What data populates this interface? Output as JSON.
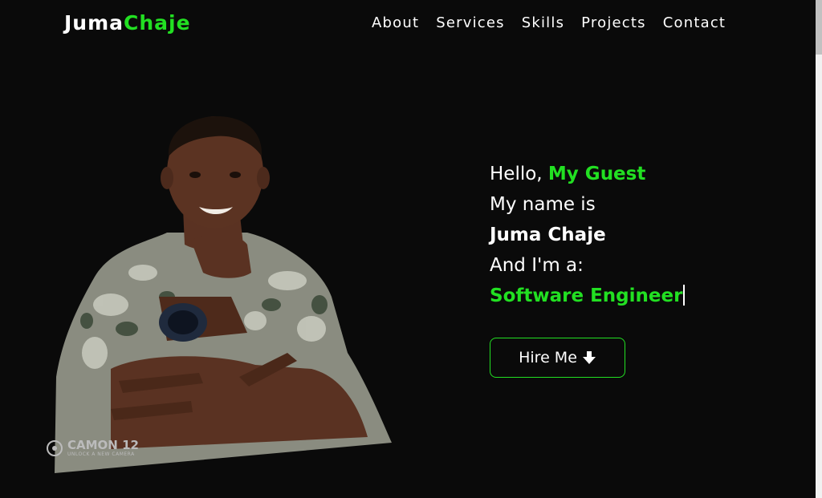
{
  "header": {
    "logo_first": "Juma",
    "logo_second": "Chaje",
    "nav": [
      {
        "label": "About"
      },
      {
        "label": "Services"
      },
      {
        "label": "Skills"
      },
      {
        "label": "Projects"
      },
      {
        "label": "Contact"
      }
    ]
  },
  "hero": {
    "greeting": "Hello,",
    "greeting_accent": "My Guest",
    "name_intro": "My name is",
    "name": "Juma Chaje",
    "role_intro": "And I'm a:",
    "role": "Software Engineer",
    "hire_button": "Hire Me",
    "hire_icon": "arrow-down-icon"
  },
  "photo": {
    "watermark_brand": "CAMON 12",
    "watermark_tag": "UNLOCK A NEW CAMERA"
  },
  "colors": {
    "background": "#0a0a0a",
    "accent": "#22e022",
    "text": "#ffffff"
  }
}
